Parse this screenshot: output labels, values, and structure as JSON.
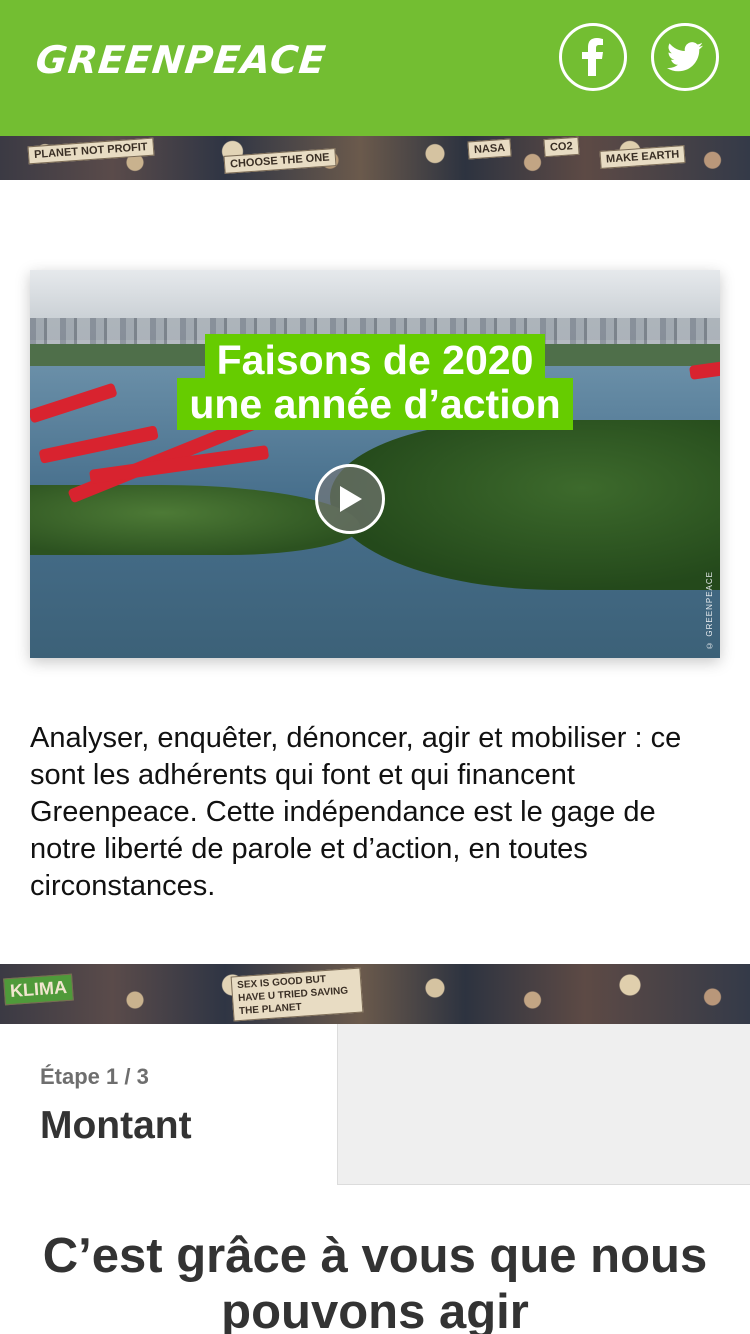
{
  "header": {
    "logo_text": "GREENPEACE",
    "brand_color": "#73be32",
    "social": [
      {
        "name": "facebook",
        "icon": "facebook-icon"
      },
      {
        "name": "twitter",
        "icon": "twitter-icon"
      }
    ]
  },
  "crowd_top_signs": [
    "PLANET NOT PROFIT",
    "CHOOSE THE ONE",
    "NASA",
    "MAKE EARTH",
    "CO2"
  ],
  "crowd_mid_signs": [
    "KLIMA",
    "SEX IS GOOD BUT HAVE U TRIED SAVING THE PLANET"
  ],
  "video": {
    "headline_line1": "Faisons de 2020",
    "headline_line2": "une année d’action",
    "credit": "© GREENPEACE",
    "accent_color": "#66cc00",
    "play_icon": "play-icon"
  },
  "intro_text": "Analyser, enquêter, dénoncer, agir et mobiliser : ce sont les adhérents qui font et qui financent Greenpeace. Cette indépendance est le gage de notre liberté de parole et d’action, en toutes circonstances.",
  "form": {
    "step_label": "Étape 1 / 3",
    "step_title": "Montant"
  },
  "cta_title": "C’est grâce à vous que nous pouvons agir"
}
